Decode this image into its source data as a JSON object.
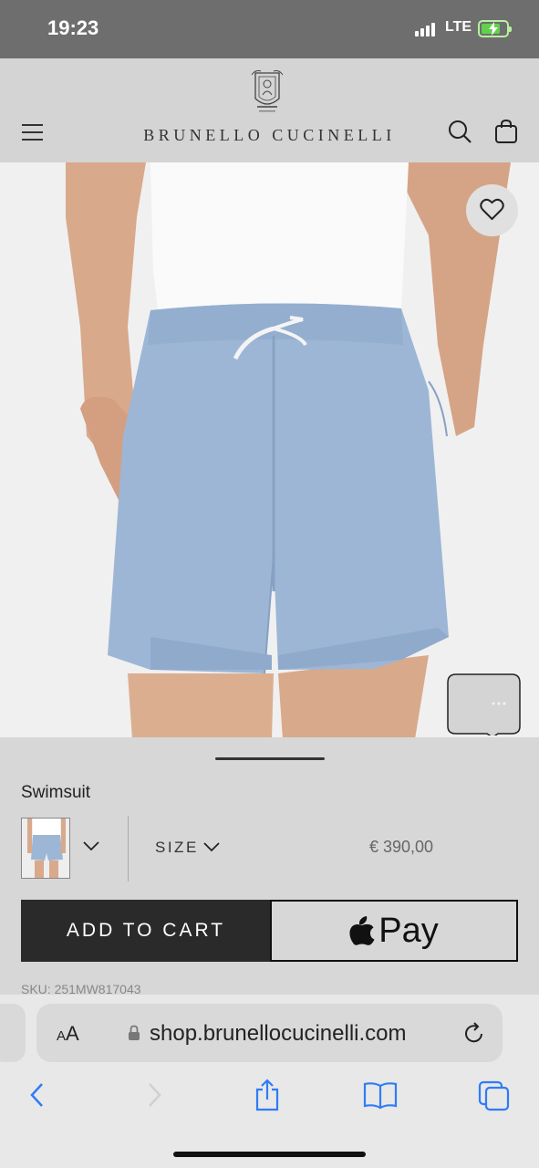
{
  "status_bar": {
    "time": "19:23",
    "network": "LTE",
    "battery_level": 0.75,
    "charging": true,
    "battery_color": "#61d14a"
  },
  "header": {
    "brand_name": "BRUNELLO CUCINELLI",
    "menu_icon": "hamburger-icon",
    "search_icon": "search-icon",
    "bag_icon": "shopping-bag-icon"
  },
  "product": {
    "name": "Swimsuit",
    "size_label": "SIZE",
    "price": "€ 390,00",
    "sku": "SKU: 251MW817043",
    "favorite_icon": "heart-icon",
    "image_subject": "light blue swim shorts",
    "shorts_color": "#9db6d6"
  },
  "actions": {
    "add_to_cart_label": "ADD TO CART",
    "apple_pay_label": "Pay"
  },
  "browser": {
    "text_size_label_small": "A",
    "text_size_label_large": "A",
    "url": "shop.brunellocucinelli.com",
    "toolbar": [
      "back-icon",
      "forward-icon",
      "share-icon",
      "bookmarks-icon",
      "tabs-icon"
    ],
    "accent_color": "#2f7cf6"
  }
}
